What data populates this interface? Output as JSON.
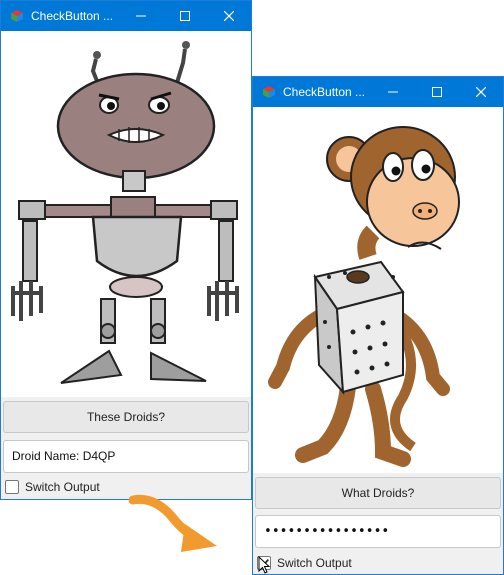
{
  "windows": [
    {
      "title": "CheckButton ...",
      "button_label": "These Droids?",
      "field_value": "Droid Name: D4QP",
      "checkbox_label": "Switch Output",
      "checkbox_checked": false,
      "image": "robot-droid-cartoon"
    },
    {
      "title": "CheckButton ...",
      "button_label": "What Droids?",
      "field_value": "••••••••••••••••",
      "checkbox_label": "Switch Output",
      "checkbox_checked": true,
      "image": "monkey-in-dice-costume-cartoon"
    }
  ],
  "decorations": {
    "arrow_color": "#f29a2e",
    "titlebar_color": "#0078d7"
  }
}
